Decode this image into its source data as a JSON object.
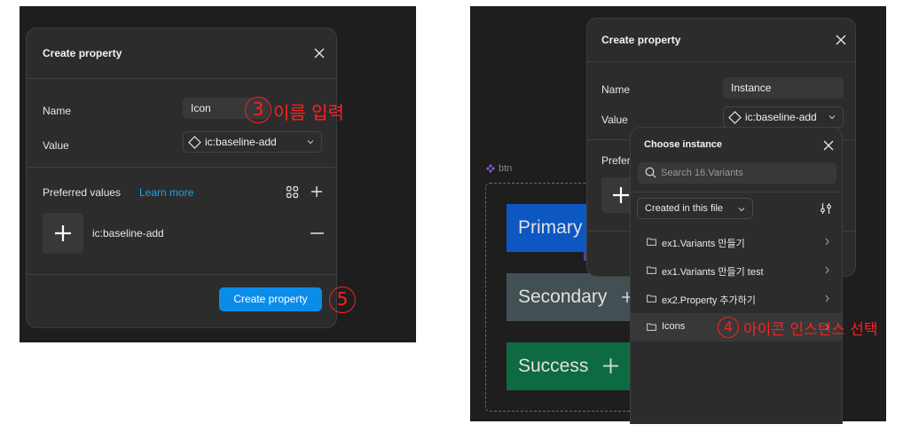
{
  "left_dialog": {
    "title": "Create property",
    "name_label": "Name",
    "name_value": "Icon",
    "value_label": "Value",
    "value_selected": "ic:baseline-add",
    "preferred_label": "Preferred values",
    "learn_more": "Learn more",
    "preferred_item": "ic:baseline-add",
    "create_button": "Create property"
  },
  "right_dialog": {
    "title": "Create property",
    "name_label": "Name",
    "name_value": "Instance",
    "value_label": "Value",
    "value_selected": "ic:baseline-add",
    "preferred_label_partial": "Prefer"
  },
  "instance_picker": {
    "title": "Choose instance",
    "search_placeholder": "Search 16.Variants",
    "filter_label": "Created in this file",
    "items": [
      {
        "label": "ex1.Variants 만들기"
      },
      {
        "label": "ex1.Variants 만들기 test"
      },
      {
        "label": "ex2.Property 추가하기"
      },
      {
        "label": "Icons"
      }
    ]
  },
  "canvas": {
    "component_label": "btn",
    "variants": [
      {
        "label": "Primary",
        "color": "#0d57c2"
      },
      {
        "label": "Secondary",
        "color": "#435053"
      },
      {
        "label": "Success",
        "color": "#0e6b41"
      }
    ]
  },
  "annotations": {
    "step3_number": "3",
    "step3_text": "이름 입력",
    "step4_number": "4",
    "step4_text": "아이콘 인스턴스 선택",
    "step5_number": "5",
    "color": "#ff1f1f"
  },
  "colors": {
    "accent": "#0c8ce9",
    "learn_more": "#1ba6e8",
    "dialog_bg": "#2c2c2c",
    "pane_bg": "#1e1e1e",
    "component_outline": "#8a5bd6"
  }
}
